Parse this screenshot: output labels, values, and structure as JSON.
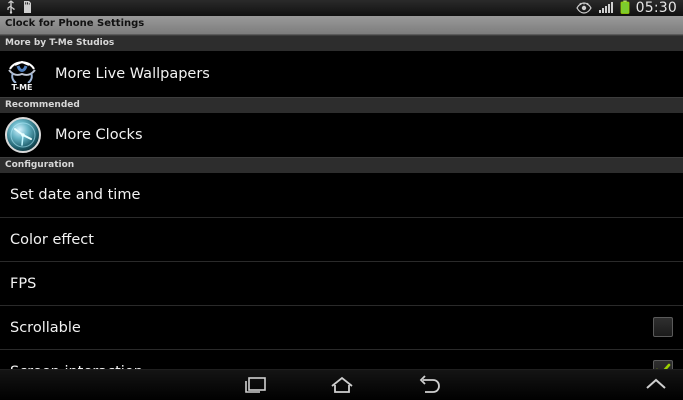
{
  "status_bar": {
    "time": "05:30",
    "icons": [
      "usb-icon",
      "sd-card-icon",
      "eye-icon",
      "signal-icon",
      "battery-icon"
    ]
  },
  "app": {
    "title": "Clock for Phone Settings"
  },
  "sections": {
    "more_by": {
      "header": "More by T-Me Studios",
      "item_label": "More Live Wallpapers",
      "item_icon": "t-me-logo-icon"
    },
    "recommended": {
      "header": "Recommended",
      "item_label": "More Clocks",
      "item_icon": "clock-app-icon"
    },
    "configuration": {
      "header": "Configuration",
      "items": [
        {
          "label": "Set date and time"
        },
        {
          "label": "Color effect"
        },
        {
          "label": "FPS"
        },
        {
          "label": "Scrollable",
          "checked": false
        },
        {
          "label": "Screen interaction",
          "checked": true
        }
      ]
    }
  },
  "nav": {
    "icons": [
      "recent-apps-icon",
      "home-icon",
      "back-icon",
      "chevron-up-icon"
    ]
  },
  "colors": {
    "background": "#000000",
    "title_bar": "#8a8a8a",
    "section_header": "#2d2d2d",
    "check_accent": "#9ad000"
  }
}
